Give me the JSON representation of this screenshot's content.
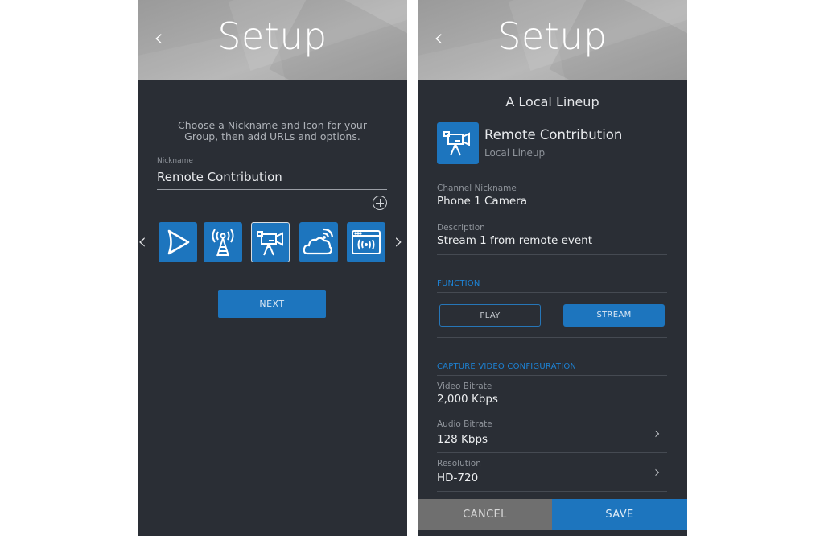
{
  "left_screen": {
    "header": {
      "title": "Setup",
      "back_icon": "chevron-left-icon"
    },
    "intro_text": "Choose a Nickname and Icon for your Group, then add URLs and options.",
    "nickname": {
      "label": "Nickname",
      "value": "Remote Contribution"
    },
    "add_icon": "plus-circle-icon",
    "icon_picker": {
      "prev_icon": "chevron-left-icon",
      "next_icon": "chevron-right-icon",
      "icons": [
        {
          "name": "play-icon",
          "selected": false
        },
        {
          "name": "broadcast-tower-icon",
          "selected": false
        },
        {
          "name": "video-camera-icon",
          "selected": true
        },
        {
          "name": "cloud-signal-icon",
          "selected": false
        },
        {
          "name": "web-stream-icon",
          "selected": false
        }
      ]
    },
    "next_label": "NEXT"
  },
  "right_screen": {
    "header": {
      "title": "Setup",
      "back_icon": "chevron-left-icon"
    },
    "lineup_title": "A Local Lineup",
    "group": {
      "name": "Remote Contribution",
      "subtitle": "Local Lineup",
      "icon": "video-camera-icon"
    },
    "channel_nickname": {
      "label": "Channel Nickname",
      "value": "Phone 1 Camera"
    },
    "description": {
      "label": "Description",
      "value": "Stream 1 from remote event"
    },
    "function": {
      "heading": "FUNCTION",
      "options": [
        "PLAY",
        "STREAM"
      ],
      "selected": "STREAM"
    },
    "capture": {
      "heading": "CAPTURE VIDEO CONFIGURATION",
      "video_bitrate": {
        "label": "Video Bitrate",
        "value": "2,000 Kbps"
      },
      "audio_bitrate": {
        "label": "Audio Bitrate",
        "value": "128 Kbps"
      },
      "resolution": {
        "label": "Resolution",
        "value": "HD-720"
      }
    },
    "footer": {
      "cancel_label": "CANCEL",
      "save_label": "SAVE"
    }
  },
  "colors": {
    "accent": "#1d75be",
    "background": "#2a2e35",
    "section_heading": "#1d82d4",
    "cancel": "#6f6f6f"
  }
}
